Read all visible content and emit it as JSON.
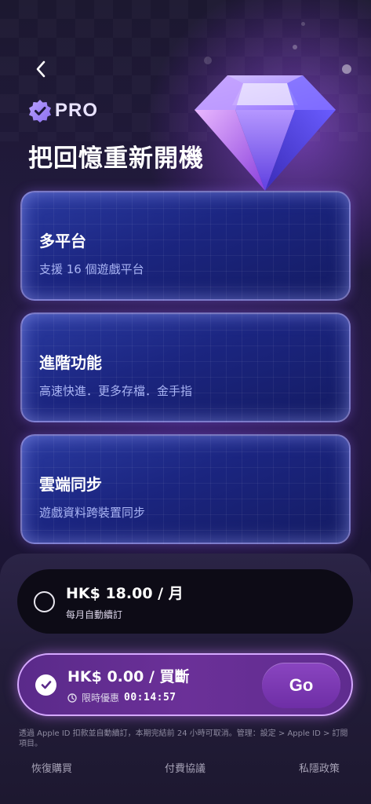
{
  "header": {
    "back_icon": "chevron-left-icon",
    "badge_icon": "verified-badge-icon",
    "pro_label": "PRO",
    "headline": "把回憶重新開機"
  },
  "features": [
    {
      "title": "多平台",
      "subtitle": "支援 16 個遊戲平台"
    },
    {
      "title": "進階功能",
      "subtitle": "高速快進．更多存檔．金手指"
    },
    {
      "title": "雲端同步",
      "subtitle": "遊戲資料跨裝置同步"
    }
  ],
  "plans": {
    "monthly": {
      "price": "HK$ 18.00 / 月",
      "note": "每月自動續訂",
      "selected": false
    },
    "lifetime": {
      "price": "HK$ 0.00 / 買斷",
      "note": "限時優惠",
      "timer": "00:14:57",
      "selected": true,
      "button": "Go"
    }
  },
  "disclaimer": "透過 Apple ID 扣款並自動續訂，本期完結前 24 小時可取消。管理：設定 > Apple ID > 訂閱項目。",
  "footer": {
    "restore": "恢復購買",
    "terms": "付費協議",
    "privacy": "私隱政策"
  },
  "colors": {
    "accent": "#6e2ea6",
    "card": "#1b2580",
    "background": "#17132a"
  }
}
